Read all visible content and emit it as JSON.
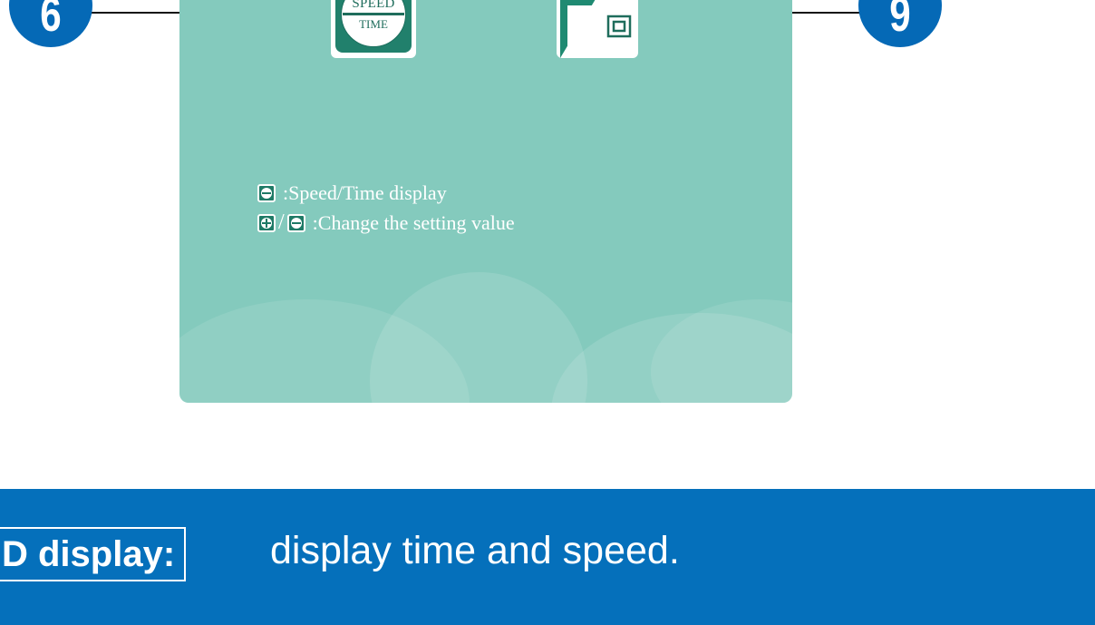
{
  "panel": {
    "background_color": "#84cabd",
    "speed_button": {
      "top_text": "SPEED",
      "bottom_text": "TIME",
      "icon": "speed-time-icon"
    },
    "play_button": {
      "icon": "play-square-icon"
    }
  },
  "callouts": [
    {
      "number": "6"
    },
    {
      "number": "9"
    }
  ],
  "legend": {
    "rows": [
      {
        "icon": "speed-time-icon",
        "text": ":Speed/Time display"
      },
      {
        "icons": [
          "plus-icon",
          "minus-icon"
        ],
        "separator": "/",
        "text": ":Change the setting value"
      }
    ]
  },
  "footer": {
    "background_color": "#0570bb",
    "label": "D display:",
    "description": "display time and speed."
  }
}
